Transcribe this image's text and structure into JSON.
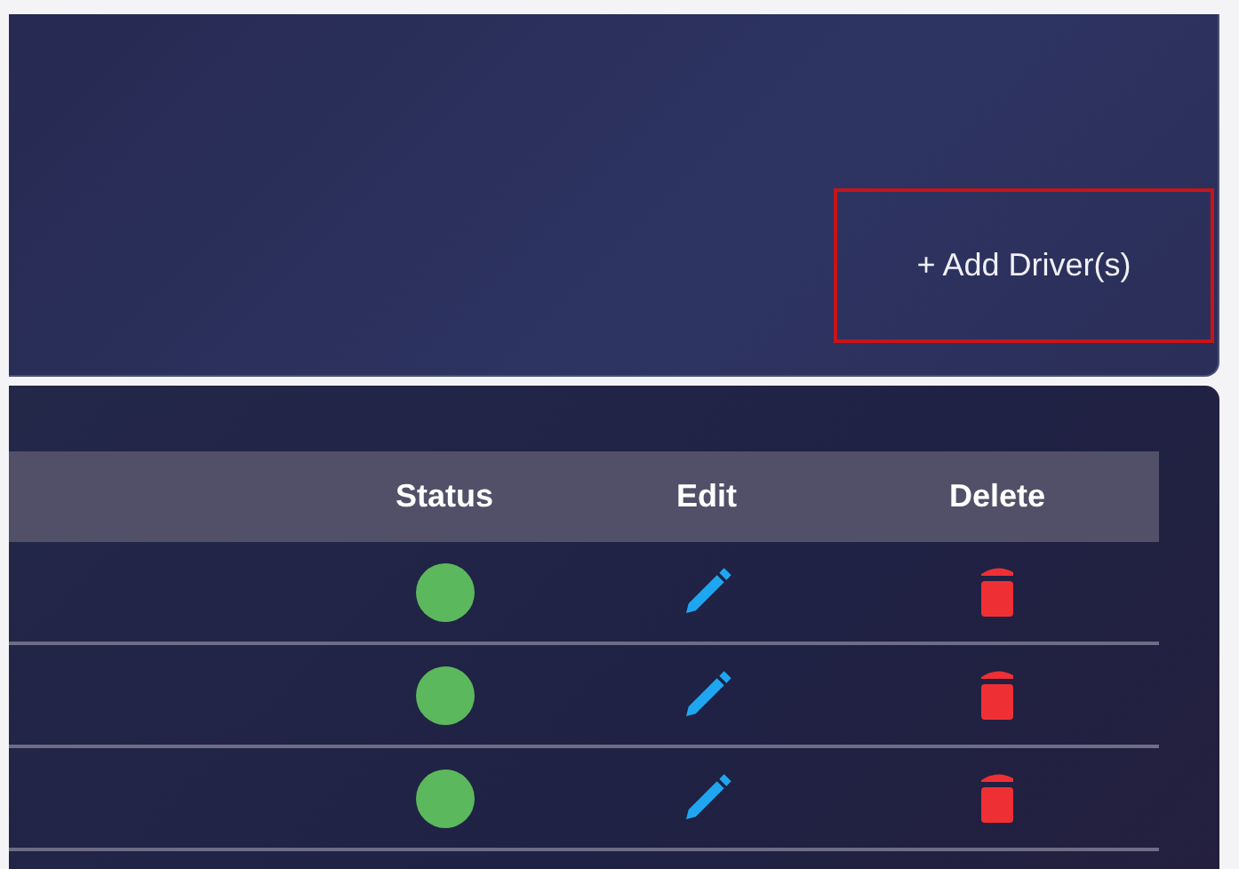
{
  "add_button": {
    "label": "+ Add Driver(s)",
    "highlighted": true
  },
  "table": {
    "columns": [
      "Status",
      "Edit",
      "Delete"
    ],
    "rows": [
      {
        "color": "#5cb85c"
      },
      {
        "color": "#5cb85c"
      },
      {
        "color": "#5cb85c"
      }
    ]
  }
}
